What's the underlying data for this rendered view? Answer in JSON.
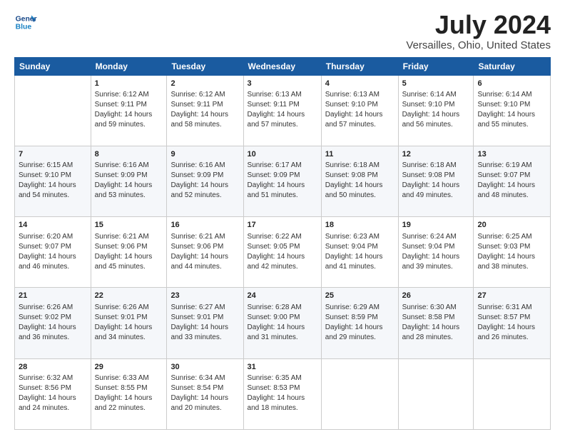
{
  "logo": {
    "line1": "General",
    "line2": "Blue"
  },
  "title": "July 2024",
  "subtitle": "Versailles, Ohio, United States",
  "days_of_week": [
    "Sunday",
    "Monday",
    "Tuesday",
    "Wednesday",
    "Thursday",
    "Friday",
    "Saturday"
  ],
  "weeks": [
    [
      {
        "day": "",
        "info": ""
      },
      {
        "day": "1",
        "info": "Sunrise: 6:12 AM\nSunset: 9:11 PM\nDaylight: 14 hours\nand 59 minutes."
      },
      {
        "day": "2",
        "info": "Sunrise: 6:12 AM\nSunset: 9:11 PM\nDaylight: 14 hours\nand 58 minutes."
      },
      {
        "day": "3",
        "info": "Sunrise: 6:13 AM\nSunset: 9:11 PM\nDaylight: 14 hours\nand 57 minutes."
      },
      {
        "day": "4",
        "info": "Sunrise: 6:13 AM\nSunset: 9:10 PM\nDaylight: 14 hours\nand 57 minutes."
      },
      {
        "day": "5",
        "info": "Sunrise: 6:14 AM\nSunset: 9:10 PM\nDaylight: 14 hours\nand 56 minutes."
      },
      {
        "day": "6",
        "info": "Sunrise: 6:14 AM\nSunset: 9:10 PM\nDaylight: 14 hours\nand 55 minutes."
      }
    ],
    [
      {
        "day": "7",
        "info": "Sunrise: 6:15 AM\nSunset: 9:10 PM\nDaylight: 14 hours\nand 54 minutes."
      },
      {
        "day": "8",
        "info": "Sunrise: 6:16 AM\nSunset: 9:09 PM\nDaylight: 14 hours\nand 53 minutes."
      },
      {
        "day": "9",
        "info": "Sunrise: 6:16 AM\nSunset: 9:09 PM\nDaylight: 14 hours\nand 52 minutes."
      },
      {
        "day": "10",
        "info": "Sunrise: 6:17 AM\nSunset: 9:09 PM\nDaylight: 14 hours\nand 51 minutes."
      },
      {
        "day": "11",
        "info": "Sunrise: 6:18 AM\nSunset: 9:08 PM\nDaylight: 14 hours\nand 50 minutes."
      },
      {
        "day": "12",
        "info": "Sunrise: 6:18 AM\nSunset: 9:08 PM\nDaylight: 14 hours\nand 49 minutes."
      },
      {
        "day": "13",
        "info": "Sunrise: 6:19 AM\nSunset: 9:07 PM\nDaylight: 14 hours\nand 48 minutes."
      }
    ],
    [
      {
        "day": "14",
        "info": "Sunrise: 6:20 AM\nSunset: 9:07 PM\nDaylight: 14 hours\nand 46 minutes."
      },
      {
        "day": "15",
        "info": "Sunrise: 6:21 AM\nSunset: 9:06 PM\nDaylight: 14 hours\nand 45 minutes."
      },
      {
        "day": "16",
        "info": "Sunrise: 6:21 AM\nSunset: 9:06 PM\nDaylight: 14 hours\nand 44 minutes."
      },
      {
        "day": "17",
        "info": "Sunrise: 6:22 AM\nSunset: 9:05 PM\nDaylight: 14 hours\nand 42 minutes."
      },
      {
        "day": "18",
        "info": "Sunrise: 6:23 AM\nSunset: 9:04 PM\nDaylight: 14 hours\nand 41 minutes."
      },
      {
        "day": "19",
        "info": "Sunrise: 6:24 AM\nSunset: 9:04 PM\nDaylight: 14 hours\nand 39 minutes."
      },
      {
        "day": "20",
        "info": "Sunrise: 6:25 AM\nSunset: 9:03 PM\nDaylight: 14 hours\nand 38 minutes."
      }
    ],
    [
      {
        "day": "21",
        "info": "Sunrise: 6:26 AM\nSunset: 9:02 PM\nDaylight: 14 hours\nand 36 minutes."
      },
      {
        "day": "22",
        "info": "Sunrise: 6:26 AM\nSunset: 9:01 PM\nDaylight: 14 hours\nand 34 minutes."
      },
      {
        "day": "23",
        "info": "Sunrise: 6:27 AM\nSunset: 9:01 PM\nDaylight: 14 hours\nand 33 minutes."
      },
      {
        "day": "24",
        "info": "Sunrise: 6:28 AM\nSunset: 9:00 PM\nDaylight: 14 hours\nand 31 minutes."
      },
      {
        "day": "25",
        "info": "Sunrise: 6:29 AM\nSunset: 8:59 PM\nDaylight: 14 hours\nand 29 minutes."
      },
      {
        "day": "26",
        "info": "Sunrise: 6:30 AM\nSunset: 8:58 PM\nDaylight: 14 hours\nand 28 minutes."
      },
      {
        "day": "27",
        "info": "Sunrise: 6:31 AM\nSunset: 8:57 PM\nDaylight: 14 hours\nand 26 minutes."
      }
    ],
    [
      {
        "day": "28",
        "info": "Sunrise: 6:32 AM\nSunset: 8:56 PM\nDaylight: 14 hours\nand 24 minutes."
      },
      {
        "day": "29",
        "info": "Sunrise: 6:33 AM\nSunset: 8:55 PM\nDaylight: 14 hours\nand 22 minutes."
      },
      {
        "day": "30",
        "info": "Sunrise: 6:34 AM\nSunset: 8:54 PM\nDaylight: 14 hours\nand 20 minutes."
      },
      {
        "day": "31",
        "info": "Sunrise: 6:35 AM\nSunset: 8:53 PM\nDaylight: 14 hours\nand 18 minutes."
      },
      {
        "day": "",
        "info": ""
      },
      {
        "day": "",
        "info": ""
      },
      {
        "day": "",
        "info": ""
      }
    ]
  ]
}
